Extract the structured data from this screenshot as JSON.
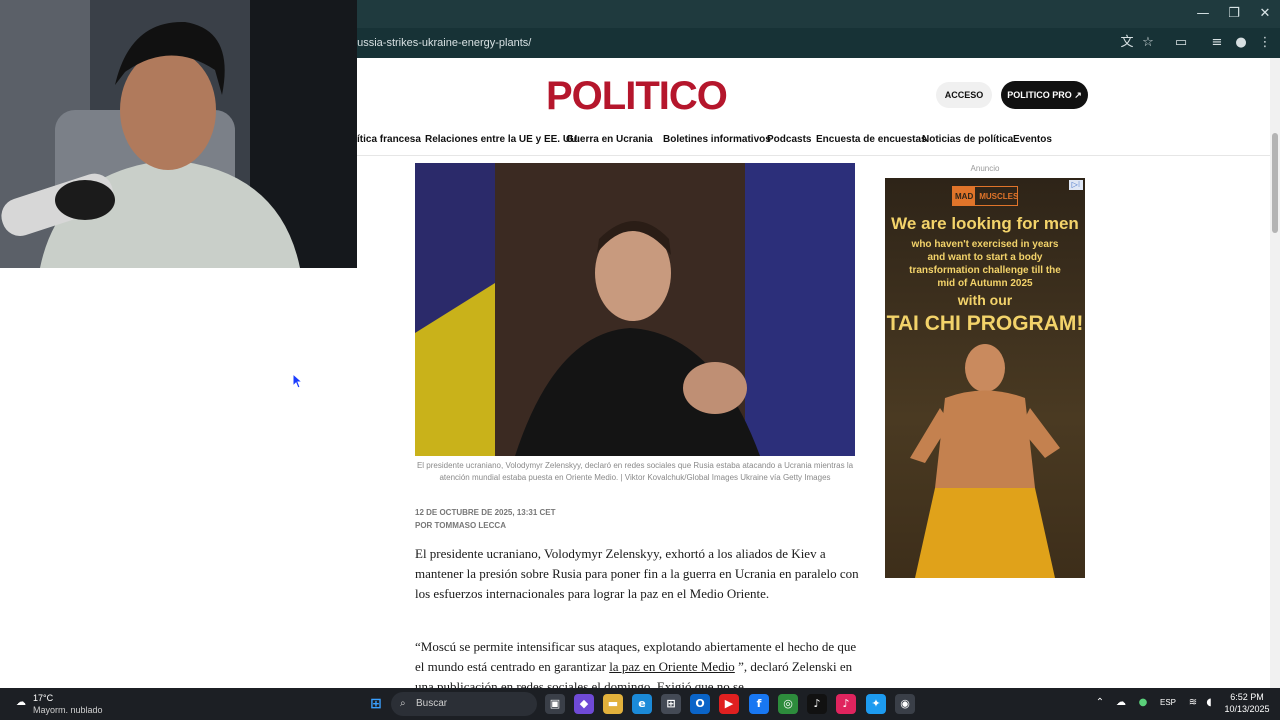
{
  "browser": {
    "url": "re-russia-strikes-ukraine-energy-plants/",
    "window_controls": [
      "—",
      "❐",
      "✕"
    ]
  },
  "site": {
    "logo": "POLITICO",
    "login_label": "ACCESO",
    "pro_label": "POLITICO PRO",
    "nav": [
      "ítica francesa",
      "Relaciones entre la UE y EE. UU.",
      "Guerra en Ucrania",
      "Boletines informativos",
      "Podcasts",
      "Encuesta de encuestas",
      "Noticias de política",
      "Eventos"
    ]
  },
  "article": {
    "caption": "El presidente ucraniano, Volodymyr Zelenskyy, declaró en redes sociales que Rusia estaba atacando a Ucrania mientras la atención mundial estaba puesta en Oriente Medio. | Viktor Kovalchuk/Global Images Ukraine vía Getty Images",
    "date": "12 DE OCTUBRE DE 2025, 13:31 CET",
    "byline": "POR TOMMASO LECCA",
    "para1": "El presidente ucraniano, Volodymyr Zelenskyy, exhortó a los aliados de Kiev a mantener la presión sobre Rusia para poner fin a la guerra en Ucrania en paralelo con los esfuerzos internacionales para lograr la paz en el Medio Oriente.",
    "para2_before": "“Moscú se permite intensificar sus ataques, explotando abiertamente el hecho de que el mundo está centrado en garantizar ",
    "para2_link": "la paz en Oriente Medio",
    "para2_after": " ”, declaró Zelenski en una publicación en redes sociales el domingo. Exigió que no se"
  },
  "ad": {
    "label": "Anuncio",
    "brand_a": "MAD",
    "brand_b": "MUSCLES",
    "headline": "We are looking for men",
    "body": "who haven't exercised in years and want to start a body transformation challenge till the mid of Autumn 2025",
    "with": "with our",
    "program": "TAI CHI PROGRAM!"
  },
  "taskbar": {
    "weather_temp": "17°C",
    "weather_desc": "Mayorm. nublado",
    "search_placeholder": "Buscar",
    "language": "ESP",
    "time": "6:52 PM",
    "date": "10/13/2025"
  },
  "colors": {
    "brand_red": "#b5162c",
    "chrome_dark": "#1f3a3e",
    "taskbar": "#1c1f24"
  }
}
